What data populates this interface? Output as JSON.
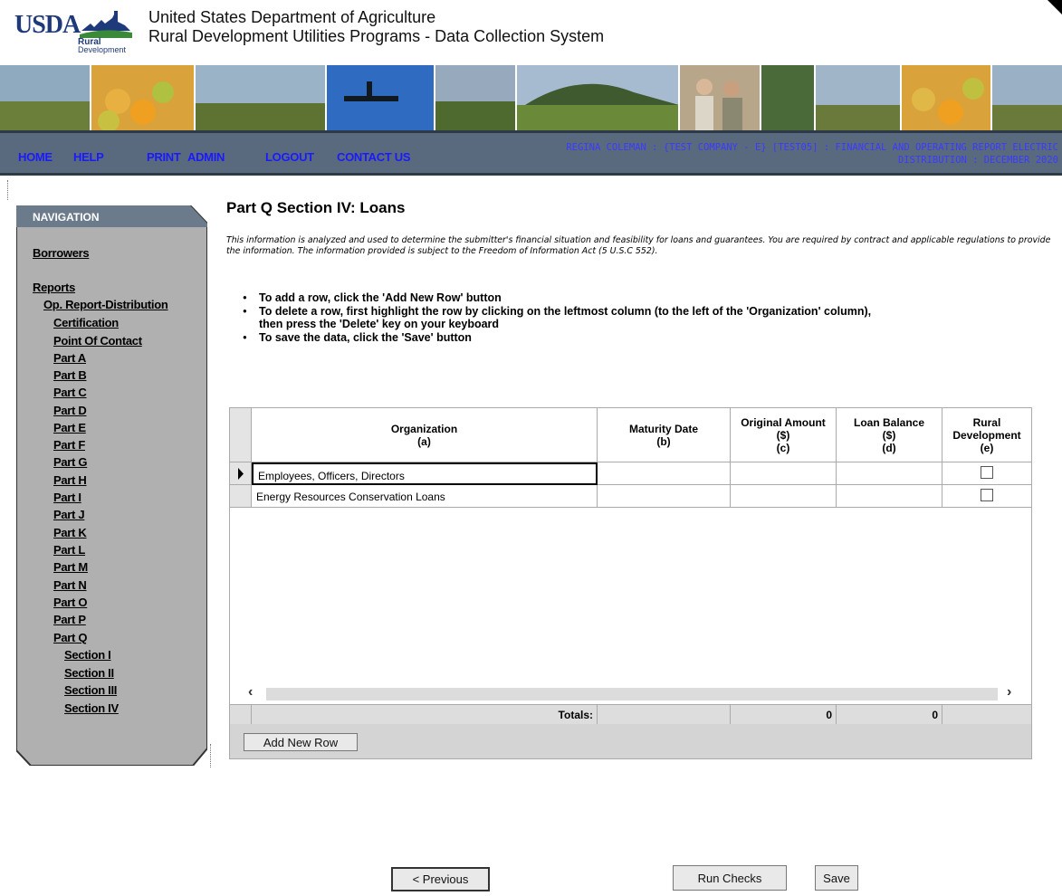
{
  "header": {
    "logo_text": "USDA",
    "logo_sub1": "Rural",
    "logo_sub2": "Development",
    "title_line1": "United States Department of Agriculture",
    "title_line2": "Rural Development Utilities Programs - Data Collection System"
  },
  "menu": {
    "home": "HOME",
    "help": "HELP",
    "print": "PRINT",
    "admin": "ADMIN",
    "logout": "LOGOUT",
    "contact": "CONTACT US",
    "user_line1": "REGINA COLEMAN : {TEST COMPANY - E} [TEST05] : FINANCIAL AND OPERATING REPORT ELECTRIC",
    "user_line2": "DISTRIBUTION : DECEMBER 2020"
  },
  "nav": {
    "title": "NAVIGATION",
    "borrowers": "Borrowers",
    "reports": "Reports",
    "op_report": "Op. Report-Distribution",
    "items": [
      "Certification",
      "Point Of Contact",
      "Part A",
      "Part B",
      "Part C",
      "Part D",
      "Part E",
      "Part F",
      "Part G",
      "Part H",
      "Part I",
      "Part J",
      "Part K",
      "Part L",
      "Part M",
      "Part N",
      "Part O",
      "Part P",
      "Part Q"
    ],
    "sections": [
      "Section I",
      "Section II",
      "Section III",
      "Section IV"
    ]
  },
  "page": {
    "title": "Part Q Section IV: Loans",
    "disclaimer": "This information is analyzed and used to determine the submitter's financial situation and feasibility for loans and guarantees. You are required by contract and applicable regulations to provide the information. The information provided is subject to the Freedom of Information Act (5 U.S.C 552).",
    "instr1": "To add a row, click the 'Add New Row' button",
    "instr2a": "To delete a row, first highlight the row by clicking on the leftmost column (to the left of the 'Organization' column),",
    "instr2b": "then press the 'Delete' key on your keyboard",
    "instr3": "To save the data, click the 'Save' button"
  },
  "grid": {
    "columns": [
      {
        "l1": "Organization",
        "l2": "(a)",
        "l3": ""
      },
      {
        "l1": "Maturity Date",
        "l2": "(b)",
        "l3": ""
      },
      {
        "l1": "Original Amount",
        "l2": "($)",
        "l3": "(c)"
      },
      {
        "l1": "Loan Balance",
        "l2": "($)",
        "l3": "(d)"
      },
      {
        "l1": "Rural",
        "l2": "Development",
        "l3": "(e)"
      }
    ],
    "rows": [
      {
        "organization": "Employees, Officers, Directors",
        "maturity": "",
        "original": "",
        "balance": "",
        "rural": false
      },
      {
        "organization": "Energy Resources Conservation Loans",
        "maturity": "",
        "original": "",
        "balance": "",
        "rural": false
      }
    ],
    "totals_label": "Totals:",
    "total_original": "0",
    "total_balance": "0",
    "add_row": "Add New Row"
  },
  "footer": {
    "previous": "< Previous",
    "run_checks": "Run Checks",
    "save": "Save"
  },
  "colors": {
    "menu_bg": "#5a6a7e",
    "menu_link": "#1a1aff",
    "nav_bg": "#b0b0b0",
    "nav_header": "#6b7b8c"
  }
}
